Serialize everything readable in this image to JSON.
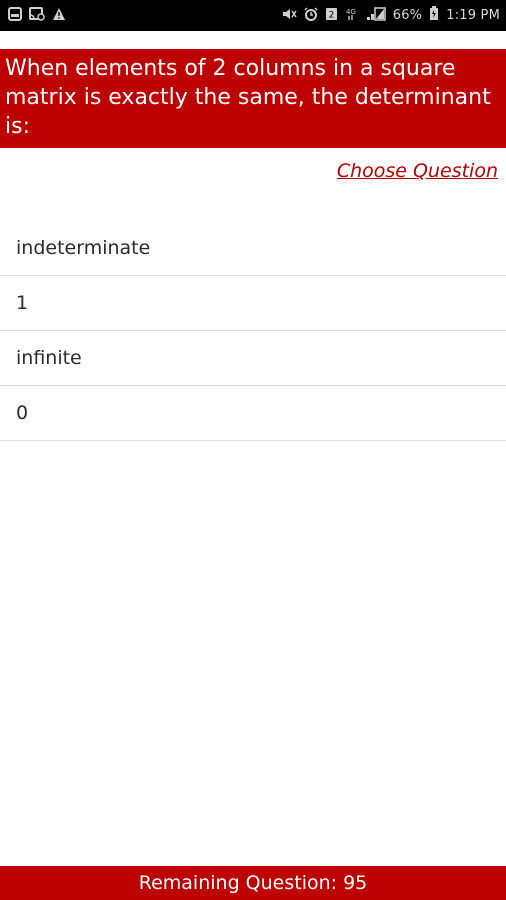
{
  "status_bar": {
    "battery": "66%",
    "time": "1:19 PM",
    "network": "4G",
    "left_icons": [
      "gallery-icon",
      "cast-icon",
      "warning-icon"
    ],
    "right_icons": [
      "mute-icon",
      "alarm-icon",
      "sim-icon",
      "network-icon",
      "signal-icon",
      "battery-icon"
    ]
  },
  "question": {
    "text": "When elements of 2 columns in a square matrix is exactly the same, the determinant is:"
  },
  "choose_question_label": "Choose Question",
  "options": [
    "indeterminate",
    "1",
    "infinite",
    "0"
  ],
  "footer": {
    "remaining_label": "Remaining Question: 95"
  },
  "colors": {
    "accent": "#bd0000",
    "status_bar": "#000000",
    "divider": "#d9d9d9"
  }
}
